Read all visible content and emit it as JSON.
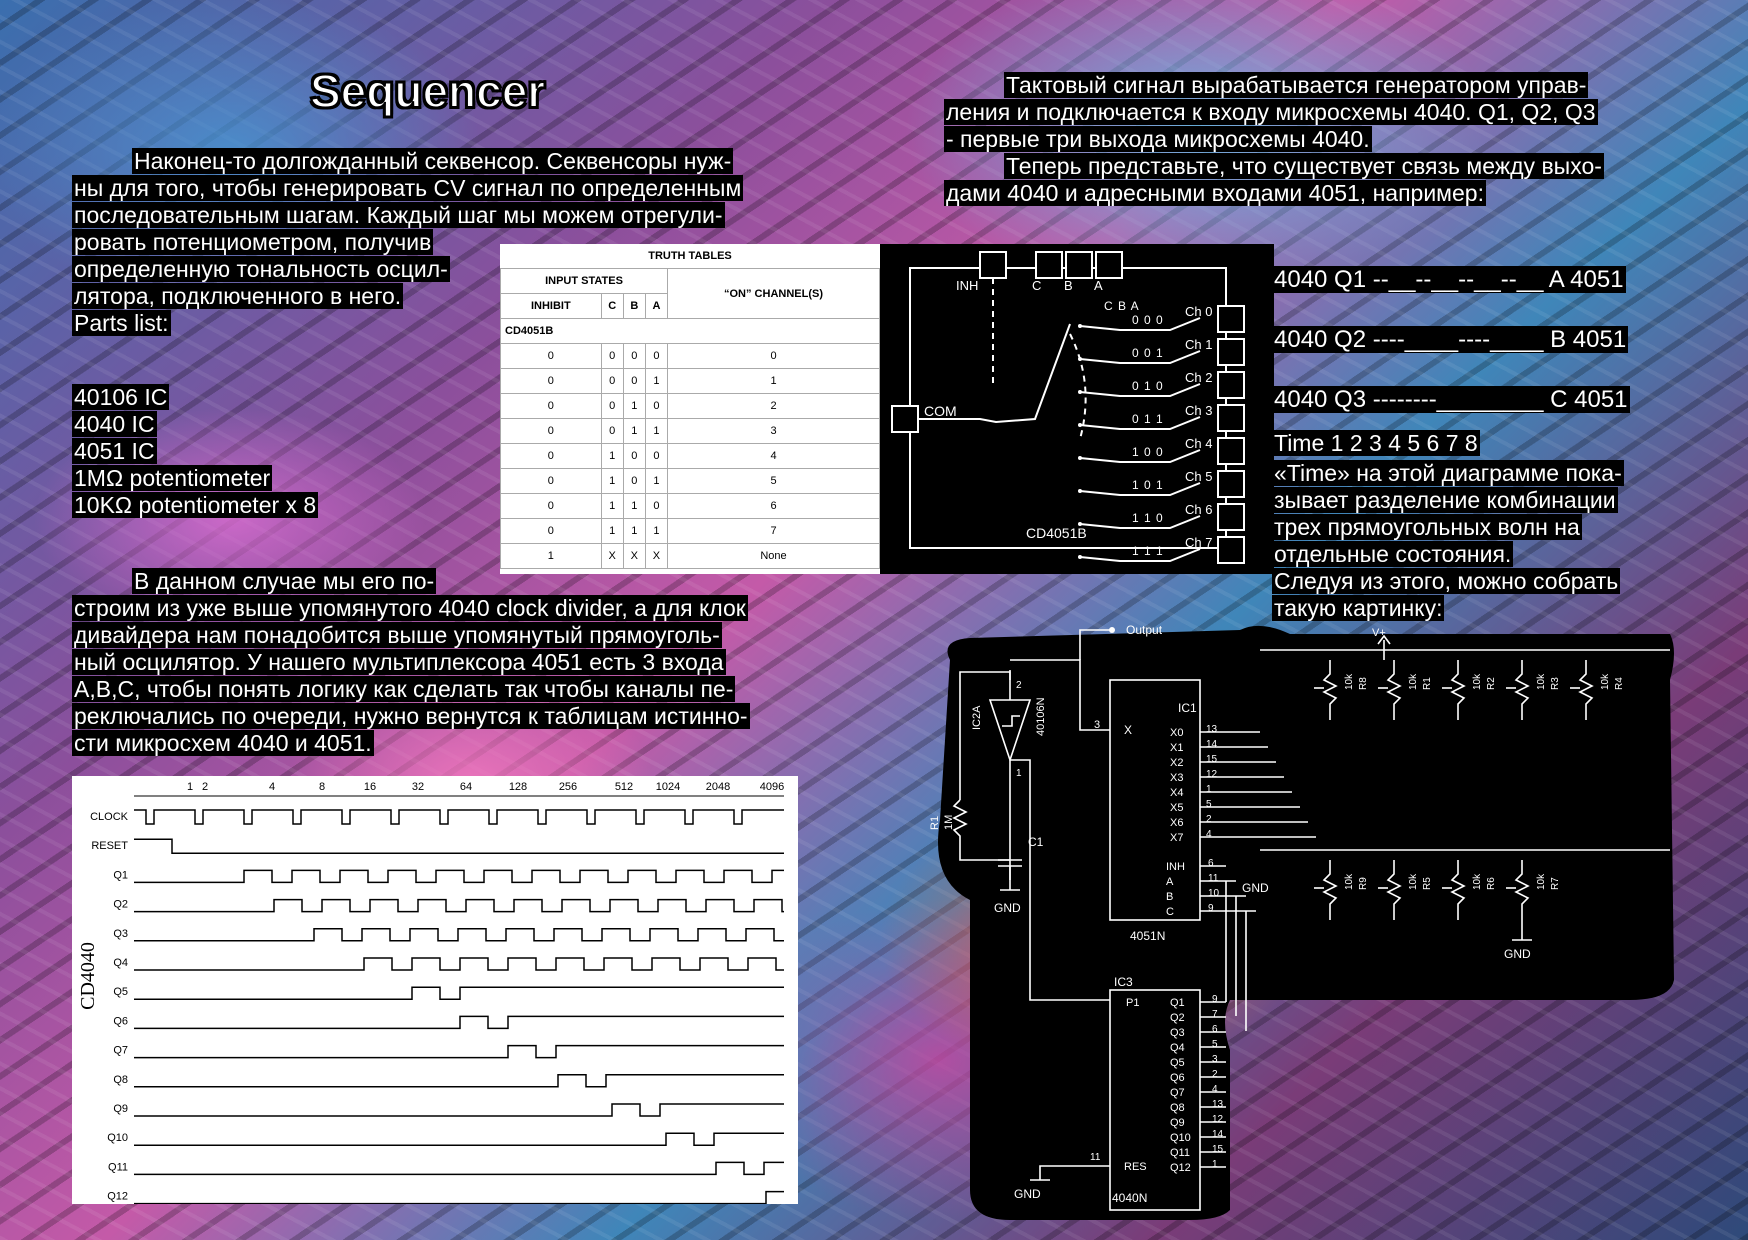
{
  "title": "Sequencer",
  "intro": {
    "lines": [
      "Наконец-то долгожданный секвенсор. Секвенсоры нуж-",
      "ны для того, чтобы генерировать CV сигнал по определенным",
      "последовательным шагам. Каждый шаг мы можем отрегули-",
      "ровать потенциометром, получив",
      "определенную тональность осцил-",
      "лятора, подключенного в него.",
      "Parts list:"
    ]
  },
  "parts": [
    "40106 IC",
    "4040 IC",
    "4051 IC",
    "1MΩ potentiometer",
    "10KΩ potentiometer x 8"
  ],
  "para2": {
    "lines": [
      "В данном случае мы его по-",
      "строим из уже выше упомянутого 4040 clock divider, а для клок",
      "дивайдера нам понадобится выше упомянутый прямоуголь-",
      "ный осцилятор. У нашего мультиплексора 4051 есть 3 входа",
      "A,B,C, чтобы понять логику как сделать так чтобы каналы пе-",
      "реключались по очереди, нужно вернутся к таблицам истинно-",
      "сти микросхем 4040 и 4051."
    ]
  },
  "right_top": {
    "lines": [
      "Тактовый сигнал вырабатывается генератором управ-",
      "ления и подключается к входу микросхемы 4040. Q1, Q2, Q3",
      "- первые три выхода микросхемы 4040.",
      "Теперь представьте, что существует связь между выхо-",
      "дами 4040 и адресными входами 4051, например:"
    ]
  },
  "mapping": [
    "4040 Q1 --__--__--__--__ A 4051",
    "4040 Q2 ----____----____ B 4051",
    "4040 Q3 --------________ C 4051"
  ],
  "time_line": "Time    1 2 3 4 5 6 7 8",
  "time_desc": {
    "lines": [
      "«Time» на этой диаграмме пока-",
      "зывает разделение комбинации",
      "трех прямоугольных волн на",
      "отдельные состояния.",
      "Следуя из этого, можно собрать",
      "такую картинку:"
    ]
  },
  "truth_table": {
    "title": "TRUTH TABLES",
    "group_header": "INPUT STATES",
    "headers": [
      "INHIBIT",
      "C",
      "B",
      "A",
      "“ON” CHANNEL(S)"
    ],
    "chip": "CD4051B",
    "rows": [
      [
        "0",
        "0",
        "0",
        "0",
        "0"
      ],
      [
        "0",
        "0",
        "0",
        "1",
        "1"
      ],
      [
        "0",
        "0",
        "1",
        "0",
        "2"
      ],
      [
        "0",
        "0",
        "1",
        "1",
        "3"
      ],
      [
        "0",
        "1",
        "0",
        "0",
        "4"
      ],
      [
        "0",
        "1",
        "0",
        "1",
        "5"
      ],
      [
        "0",
        "1",
        "1",
        "0",
        "6"
      ],
      [
        "0",
        "1",
        "1",
        "1",
        "7"
      ],
      [
        "1",
        "X",
        "X",
        "X",
        "None"
      ]
    ]
  },
  "switch_diagram": {
    "inh": "INH",
    "c": "C",
    "b": "B",
    "a": "A",
    "cba": "C B A",
    "com": "COM",
    "chip": "CD4051B",
    "codes": [
      "0 0 0",
      "0 0 1",
      "0 1 0",
      "0 1 1",
      "1 0 0",
      "1 0 1",
      "1 1 0",
      "1 1 1"
    ],
    "channels": [
      "Ch 0",
      "Ch 1",
      "Ch 2",
      "Ch 3",
      "Ch 4",
      "Ch 5",
      "Ch 6",
      "Ch 7"
    ]
  },
  "timing": {
    "chip": "CD4040",
    "counts": [
      "1",
      "2",
      "4",
      "8",
      "16",
      "32",
      "64",
      "128",
      "256",
      "512",
      "1024",
      "2048",
      "4096"
    ],
    "signals": [
      "CLOCK",
      "RESET",
      "Q1",
      "Q2",
      "Q3",
      "Q4",
      "Q5",
      "Q6",
      "Q7",
      "Q8",
      "Q9",
      "Q10",
      "Q11",
      "Q12"
    ]
  },
  "schematic": {
    "output": "Output",
    "ic1": "IC1",
    "ic1_name": "4051N",
    "ic1_pins_left": [
      "X"
    ],
    "ic1_outputs": [
      "X0",
      "X1",
      "X2",
      "X3",
      "X4",
      "X5",
      "X6",
      "X7"
    ],
    "ic1_out_nums": [
      "13",
      "14",
      "15",
      "12",
      "1",
      "5",
      "2",
      "4"
    ],
    "ic1_ctrl": [
      "INH",
      "A",
      "B",
      "C"
    ],
    "ic1_ctrl_nums": [
      "6",
      "11",
      "10",
      "9"
    ],
    "ic1_x_num": "3",
    "ic2": "IC2A",
    "ic2_name": "40106N",
    "ic2_pins": [
      "2",
      "1"
    ],
    "ic3": "IC3",
    "ic3_name": "4040N",
    "ic3_p1": "P1",
    "ic3_res": "RES",
    "ic3_res_num": "11",
    "ic3_outputs": [
      "Q1",
      "Q2",
      "Q3",
      "Q4",
      "Q5",
      "Q6",
      "Q7",
      "Q8",
      "Q9",
      "Q10",
      "Q11",
      "Q12"
    ],
    "ic3_out_nums": [
      "9",
      "7",
      "6",
      "5",
      "3",
      "2",
      "4",
      "13",
      "12",
      "14",
      "15",
      "1"
    ],
    "r1": "R1",
    "r1_val": "1M",
    "c1": "C1",
    "gnd": "GND",
    "vplus": "V+",
    "pots_top": [
      [
        "10k",
        "R8"
      ],
      [
        "10k",
        "R1"
      ],
      [
        "10k",
        "R2"
      ],
      [
        "10k",
        "R3"
      ],
      [
        "10k",
        "R4"
      ]
    ],
    "pots_bottom": [
      [
        "10k",
        "R9"
      ],
      [
        "10k",
        "R5"
      ],
      [
        "10k",
        "R6"
      ],
      [
        "10k",
        "R7"
      ]
    ]
  }
}
